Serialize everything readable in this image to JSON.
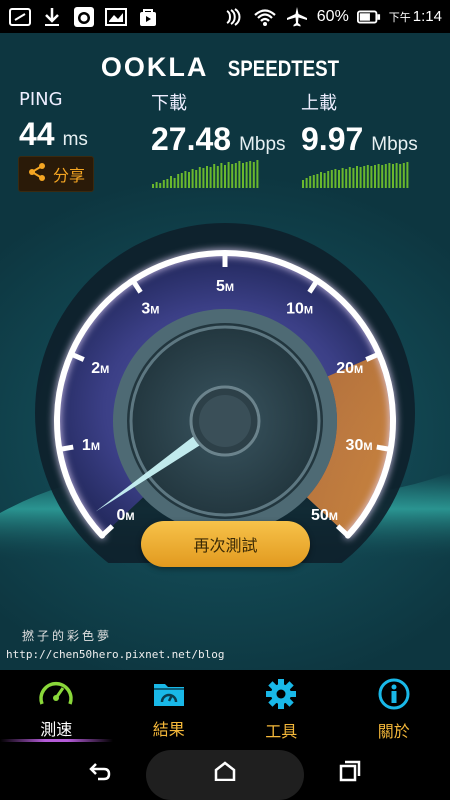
{
  "status_bar": {
    "battery_percent": "60%",
    "time_prefix": "下午",
    "time": "1:14"
  },
  "app": {
    "logo_main": "OOKLA",
    "logo_sub": "SPEEDTEST"
  },
  "results": {
    "ping": {
      "label": "PING",
      "value": "44",
      "unit": "ms"
    },
    "download": {
      "label": "下載",
      "value": "27.48",
      "unit": "Mbps"
    },
    "upload": {
      "label": "上載",
      "value": "9.97",
      "unit": "Mbps"
    },
    "share_label": "分享"
  },
  "gauge": {
    "ticks": [
      {
        "n": "0",
        "u": "M"
      },
      {
        "n": "1",
        "u": "M"
      },
      {
        "n": "2",
        "u": "M"
      },
      {
        "n": "3",
        "u": "M"
      },
      {
        "n": "5",
        "u": "M"
      },
      {
        "n": "10",
        "u": "M"
      },
      {
        "n": "20",
        "u": "M"
      },
      {
        "n": "30",
        "u": "M"
      },
      {
        "n": "50",
        "u": "M"
      }
    ],
    "needle_value_mbps": 0.5
  },
  "retest_label": "再次測試",
  "watermark": {
    "title": "撚子的彩色夢",
    "url": "http://chen50hero.pixnet.net/blog"
  },
  "nav": [
    {
      "label": "測速",
      "icon": "speedometer-icon",
      "active": true
    },
    {
      "label": "結果",
      "icon": "results-folder-icon",
      "active": false
    },
    {
      "label": "工具",
      "icon": "gear-icon",
      "active": false
    },
    {
      "label": "關於",
      "icon": "info-icon",
      "active": false
    }
  ],
  "colors": {
    "accent": "#f5b83a",
    "gauge_arc": "#ffffff",
    "gauge_hot": "#d9782a",
    "nav_active": "#b55cd8"
  }
}
